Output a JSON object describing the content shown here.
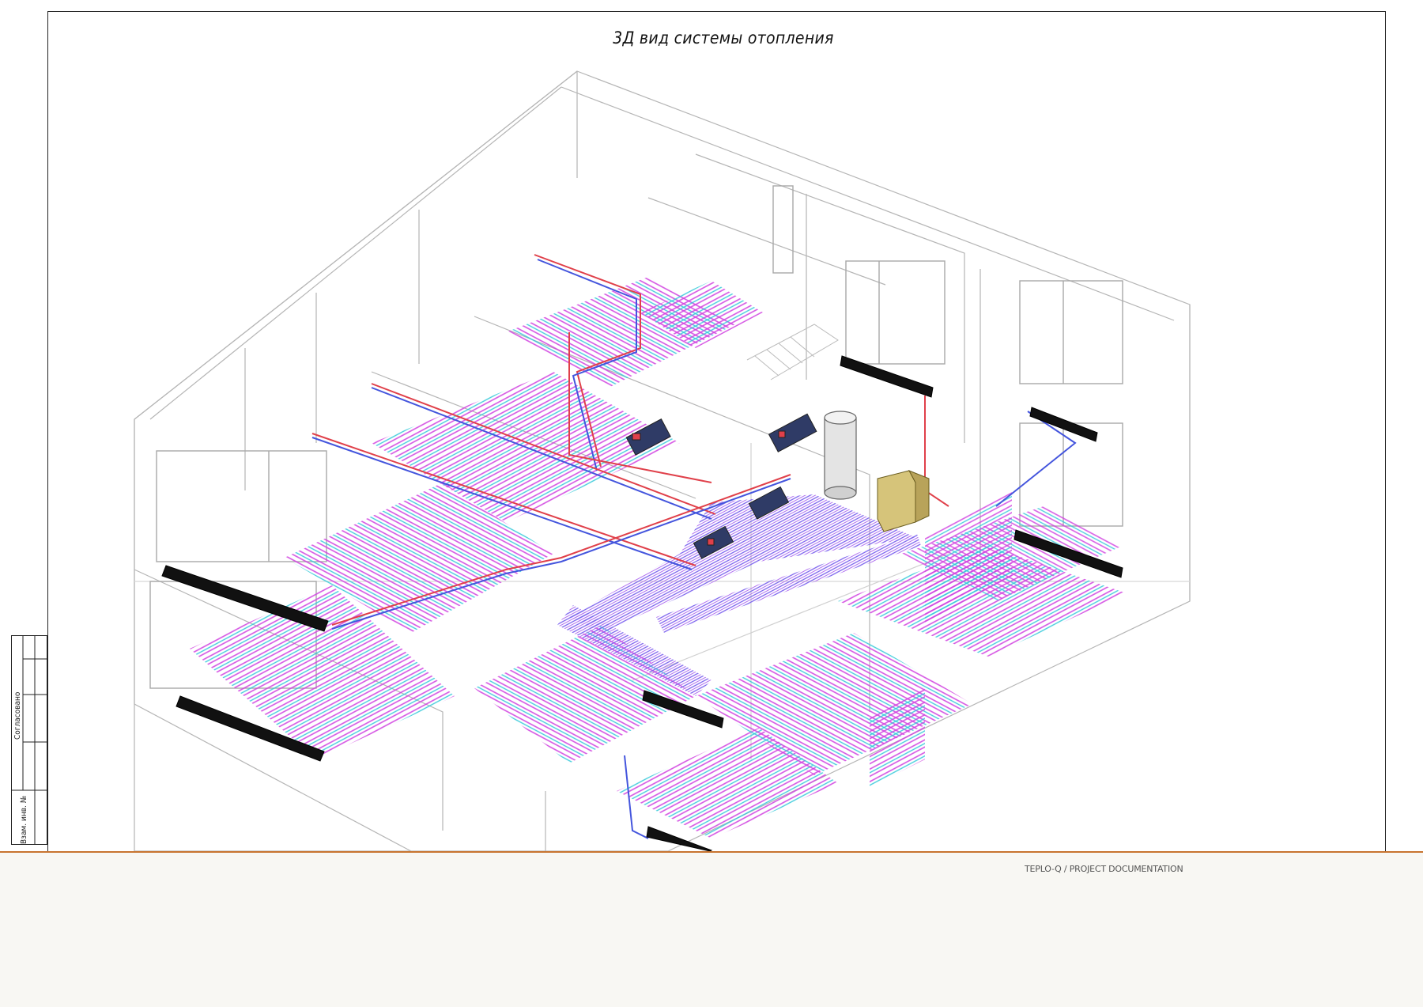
{
  "sheet": {
    "title": "3Д вид системы отопления"
  },
  "stamp": {
    "approved_label": "Согласовано",
    "inventory_label": "Взам. инв. №"
  },
  "footer": {
    "text": "TEPLO-Q / PROJECT DOCUMENTATION"
  },
  "colors": {
    "supply_pipe": "#e0404a",
    "return_pipe": "#4455dd",
    "floor_loop_magenta": "#d040e0",
    "floor_loop_cyan": "#30c8d8",
    "walls": "#b8b8b8",
    "radiator": "#111111",
    "footer_line": "#c8742f"
  },
  "icons": {
    "boiler": "boiler-icon",
    "tank": "water-tank-icon",
    "manifold": "manifold-icon",
    "radiator": "radiator-icon"
  }
}
